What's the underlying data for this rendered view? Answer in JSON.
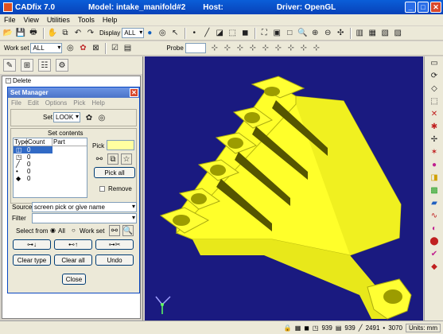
{
  "window": {
    "app": "CADfix 7.0",
    "model": "Model: intake_manifold#2",
    "host": "Host:",
    "driver": "Driver: OpenGL"
  },
  "menu": [
    "File",
    "View",
    "Utilities",
    "Tools",
    "Help"
  ],
  "toolbar1": {
    "display_label": "Display",
    "display_value": "ALL"
  },
  "toolbar2": {
    "workset_label": "Work set",
    "workset_value": "ALL",
    "probe_label": "Probe"
  },
  "tree": {
    "delete_label": "Delete"
  },
  "set_manager": {
    "title": "Set Manager",
    "menu": [
      "File",
      "Edit",
      "Options",
      "Pick",
      "Help"
    ],
    "set_label": "Set",
    "set_value": "LOOK",
    "contents_label": "Set contents",
    "headers": [
      "Type",
      "Count",
      "Part"
    ],
    "rows": [
      {
        "type_icon": "cube-icon",
        "count": "0"
      },
      {
        "type_icon": "face-icon",
        "count": "0"
      },
      {
        "type_icon": "edge-icon",
        "count": "0"
      },
      {
        "type_icon": "vertex-icon",
        "count": "0"
      },
      {
        "type_icon": "point-icon",
        "count": "0"
      }
    ],
    "pick_label": "Pick",
    "pick_all": "Pick all",
    "remove_label": "Remove",
    "source_label": "Source",
    "source_value": "screen pick or give name",
    "filter_label": "Filter",
    "select_from_label": "Select from",
    "all_label": "All",
    "workset_label": "Work set",
    "clear_type": "Clear type",
    "clear_all": "Clear all",
    "undo": "Undo",
    "close": "Close"
  },
  "status": {
    "count1": "939",
    "count2": "939",
    "count3": "2491",
    "count4": "3070",
    "units": "Units: mm"
  },
  "colors": {
    "viewport_bg": "#1a1a80",
    "model": "#ffff2a",
    "titlebar": "#0a5ed8"
  }
}
